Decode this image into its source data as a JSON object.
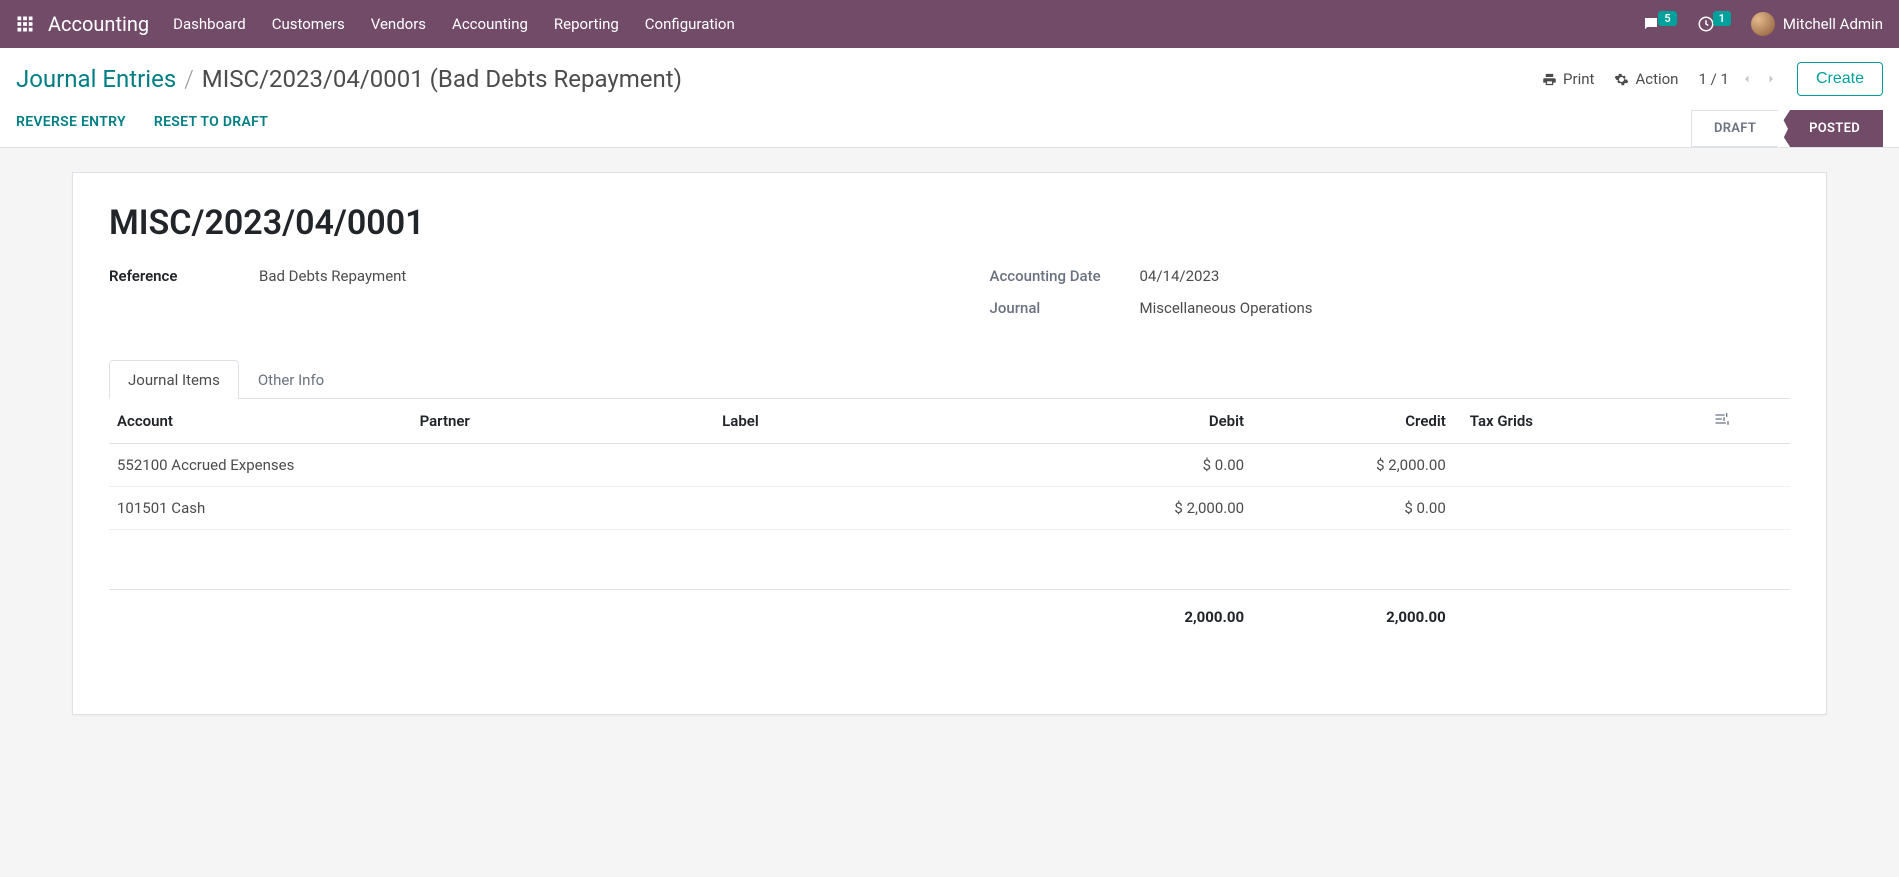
{
  "topbar": {
    "app_title": "Accounting",
    "menu": [
      "Dashboard",
      "Customers",
      "Vendors",
      "Accounting",
      "Reporting",
      "Configuration"
    ],
    "msg_count": "5",
    "clock_count": "1",
    "user_name": "Mitchell Admin"
  },
  "control": {
    "breadcrumb_root": "Journal Entries",
    "breadcrumb_current": "MISC/2023/04/0001 (Bad Debts Repayment)",
    "print": "Print",
    "action": "Action",
    "pager": "1 / 1",
    "create": "Create",
    "reverse": "REVERSE ENTRY",
    "reset": "RESET TO DRAFT",
    "state_draft": "DRAFT",
    "state_posted": "POSTED"
  },
  "sheet": {
    "title": "MISC/2023/04/0001",
    "reference_label": "Reference",
    "reference_value": "Bad Debts Repayment",
    "date_label": "Accounting Date",
    "date_value": "04/14/2023",
    "journal_label": "Journal",
    "journal_value": "Miscellaneous Operations",
    "tab_items": "Journal Items",
    "tab_other": "Other Info",
    "cols": {
      "account": "Account",
      "partner": "Partner",
      "label": "Label",
      "debit": "Debit",
      "credit": "Credit",
      "taxgrids": "Tax Grids"
    },
    "lines": [
      {
        "account": "552100 Accrued Expenses",
        "partner": "",
        "label": "",
        "debit": "$ 0.00",
        "credit": "$ 2,000.00"
      },
      {
        "account": "101501 Cash",
        "partner": "",
        "label": "",
        "debit": "$ 2,000.00",
        "credit": "$ 0.00"
      }
    ],
    "total_debit": "2,000.00",
    "total_credit": "2,000.00"
  }
}
